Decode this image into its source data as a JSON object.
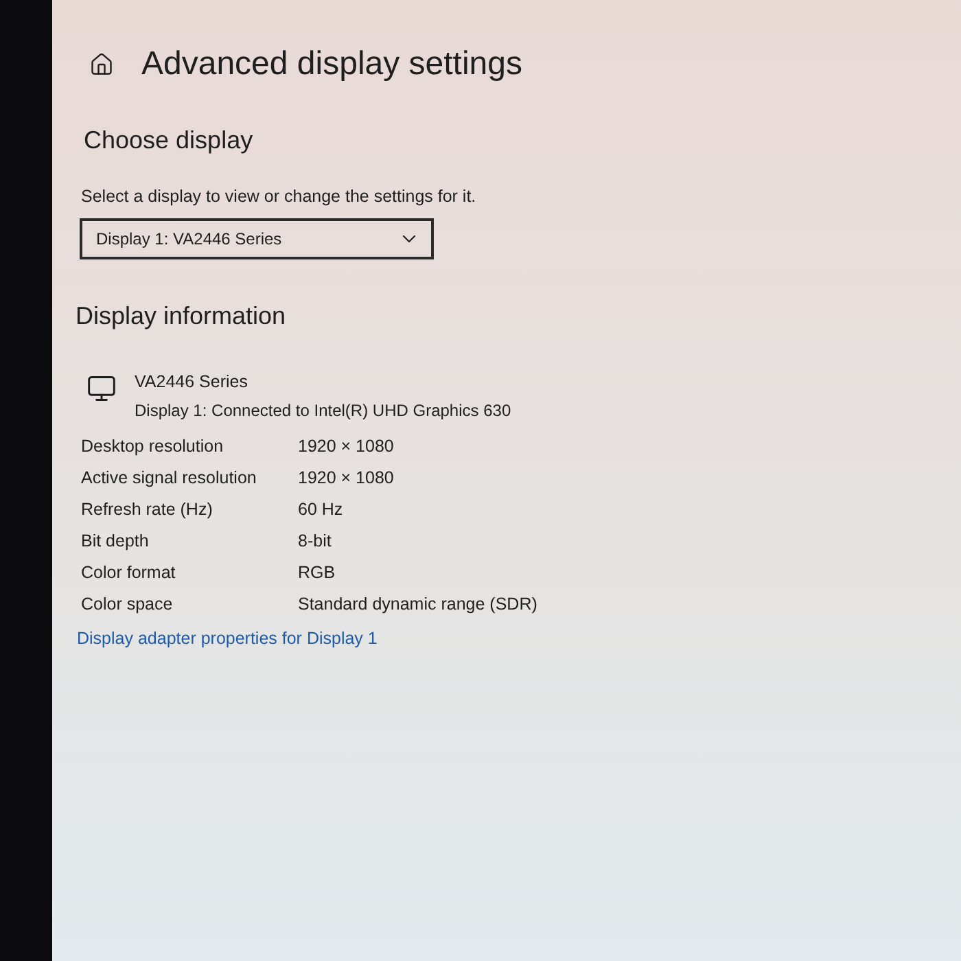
{
  "page": {
    "title": "Advanced display settings"
  },
  "choose_display": {
    "heading": "Choose display",
    "description": "Select a display to view or change the settings for it.",
    "dropdown": {
      "value": "Display 1: VA2446 Series"
    }
  },
  "display_information": {
    "heading": "Display information",
    "monitor": {
      "name": "VA2446 Series",
      "connection": "Display 1: Connected to Intel(R) UHD Graphics 630"
    },
    "rows": [
      {
        "label": "Desktop resolution",
        "value": "1920 × 1080"
      },
      {
        "label": "Active signal resolution",
        "value": "1920 × 1080"
      },
      {
        "label": "Refresh rate (Hz)",
        "value": "60 Hz"
      },
      {
        "label": "Bit depth",
        "value": "8-bit"
      },
      {
        "label": "Color format",
        "value": "RGB"
      },
      {
        "label": "Color space",
        "value": "Standard dynamic range (SDR)"
      }
    ],
    "link": "Display adapter properties for Display 1"
  }
}
